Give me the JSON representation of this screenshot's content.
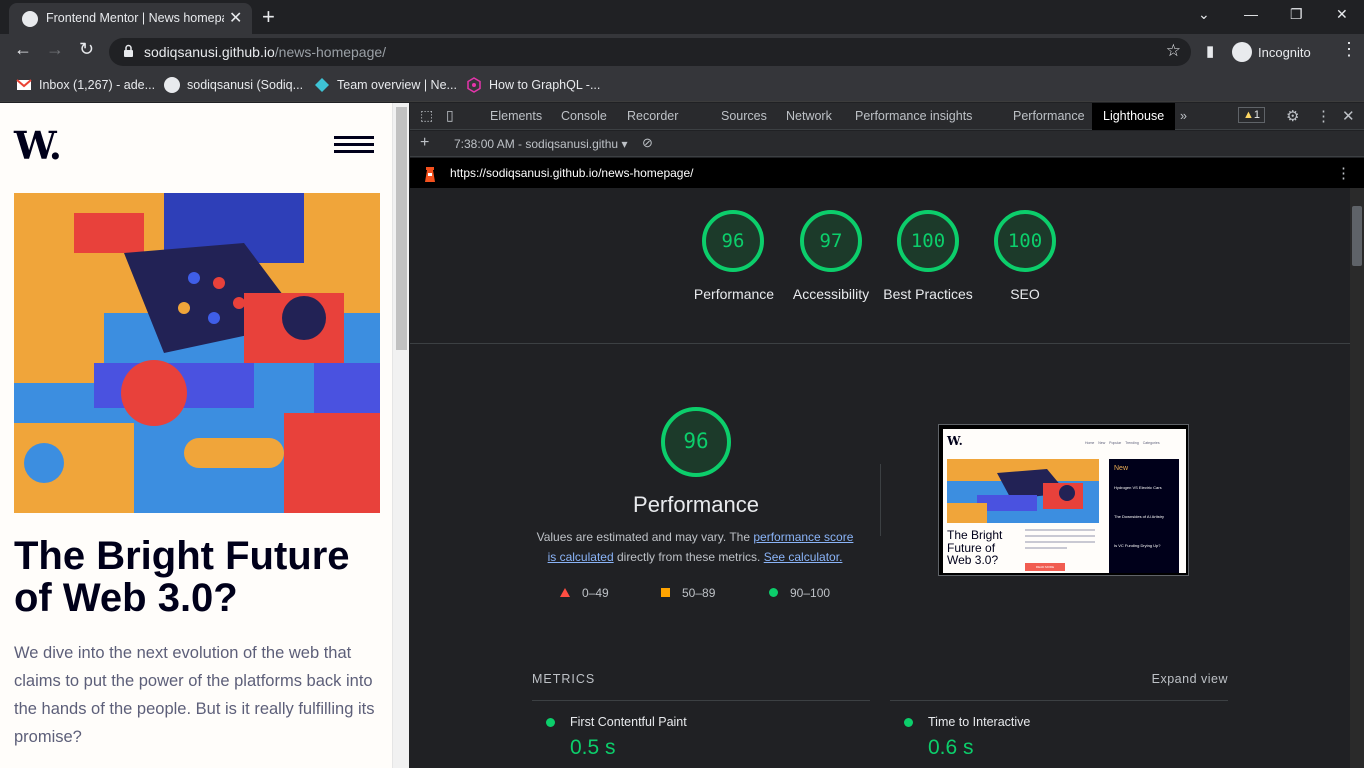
{
  "browser": {
    "tab_title": "Frontend Mentor | News homepage",
    "url_host": "sodiqsanusi.github.io",
    "url_path": "/news-homepage/",
    "profile_label": "Incognito",
    "bookmarks": [
      {
        "label": "Inbox (1,267) - ade..."
      },
      {
        "label": "sodiqsanusi (Sodiq..."
      },
      {
        "label": "Team overview | Ne..."
      },
      {
        "label": "How to GraphQL -..."
      }
    ]
  },
  "page": {
    "logo": "W.",
    "headline": "The Bright Future of Web 3.0?",
    "lede": "We dive into the next evolution of the web that claims to put the power of the platforms back into the hands of the people. But is it really fulfilling its promise?"
  },
  "devtools": {
    "tabs": [
      "Elements",
      "Console",
      "Recorder",
      "Sources",
      "Network",
      "Performance insights",
      "Performance",
      "Lighthouse"
    ],
    "active_tab": "Lighthouse",
    "warning_count": "1",
    "report_select": "7:38:00 AM - sodiqsanusi.githu",
    "report_url": "https://sodiqsanusi.github.io/news-homepage/"
  },
  "lighthouse": {
    "scores": [
      {
        "value": "96",
        "label": "Performance"
      },
      {
        "value": "97",
        "label": "Accessibility"
      },
      {
        "value": "100",
        "label": "Best Practices"
      },
      {
        "value": "100",
        "label": "SEO"
      }
    ],
    "performance": {
      "score": "96",
      "title": "Performance",
      "desc_pre": "Values are estimated and may vary. The ",
      "desc_link1": "performance score is calculated",
      "desc_mid": " directly from these metrics. ",
      "desc_link2": "See calculator."
    },
    "legend": [
      {
        "range": "0–49",
        "color": "#ff4e42"
      },
      {
        "range": "50–89",
        "color": "#ffa400"
      },
      {
        "range": "90–100",
        "color": "#0cce6b"
      }
    ],
    "metrics_title": "METRICS",
    "expand_label": "Expand view",
    "metrics": [
      {
        "name": "First Contentful Paint",
        "value": "0.5 s"
      },
      {
        "name": "Time to Interactive",
        "value": "0.6 s"
      }
    ],
    "thumbnail": {
      "logo": "W.",
      "nav": [
        "Home",
        "New",
        "Popular",
        "Trending",
        "Categories"
      ],
      "headline": "The Bright Future of Web 3.0?",
      "sidebar_title": "New",
      "sidebar_items": [
        "Hydrogen VS Electric Cars",
        "The Downsides of AI Artistry",
        "Is VC Funding Drying Up?"
      ],
      "button": "READ MORE"
    },
    "colors": {
      "pass": "#0cce6b",
      "average": "#ffa400",
      "fail": "#ff4e42"
    }
  }
}
